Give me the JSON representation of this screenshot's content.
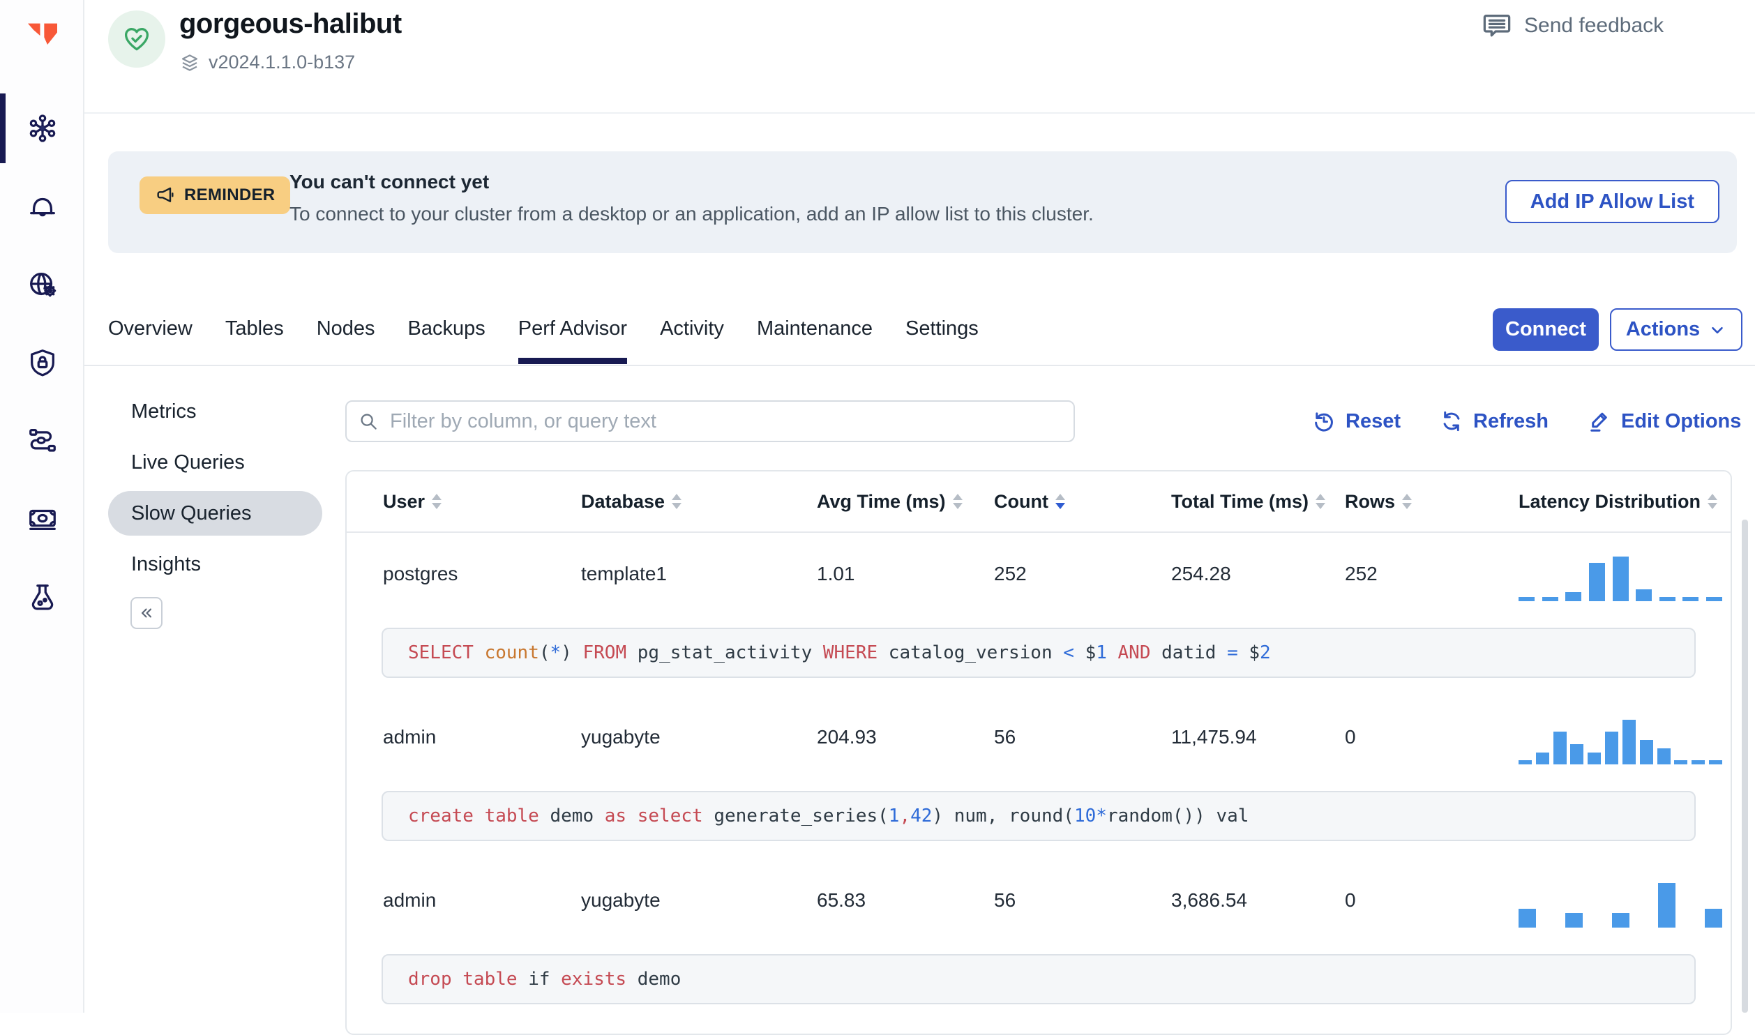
{
  "header": {
    "cluster_name": "gorgeous-halibut",
    "version": "v2024.1.1.0-b137",
    "send_feedback": "Send feedback"
  },
  "rail": {
    "icons": [
      "yugabyte-logo",
      "clusters",
      "alerts",
      "network-access",
      "security",
      "integrations",
      "usage-billing",
      "labs"
    ],
    "active": "clusters"
  },
  "banner": {
    "badge": "REMINDER",
    "title": "You can't connect yet",
    "message": "To connect to your cluster from a desktop or an application, add an IP allow list to this cluster.",
    "action": "Add IP Allow List"
  },
  "nav_tabs": {
    "items": [
      "Overview",
      "Tables",
      "Nodes",
      "Backups",
      "Perf Advisor",
      "Activity",
      "Maintenance",
      "Settings"
    ],
    "active": "Perf Advisor"
  },
  "cluster_actions": {
    "connect": "Connect",
    "actions": "Actions"
  },
  "subnav": {
    "items": [
      "Metrics",
      "Live Queries",
      "Slow Queries",
      "Insights"
    ],
    "active": "Slow Queries",
    "collapse_glyph": "«"
  },
  "toolbar": {
    "filter_placeholder": "Filter by column, or query text",
    "reset": "Reset",
    "refresh": "Refresh",
    "edit_options": "Edit Options"
  },
  "table": {
    "columns": [
      "User",
      "Database",
      "Avg Time (ms)",
      "Count",
      "Total Time (ms)",
      "Rows",
      "Latency Distribution"
    ],
    "sort": {
      "column": "Count",
      "direction": "desc"
    },
    "rows": [
      {
        "user": "postgres",
        "database": "template1",
        "avg_time_ms": "1.01",
        "count": "252",
        "total_time_ms": "254.28",
        "rows": "252",
        "query_tokens": [
          [
            "kw",
            "SELECT "
          ],
          [
            "fn",
            "count"
          ],
          [
            "p",
            "("
          ],
          [
            "num",
            "*"
          ],
          [
            "p",
            ") "
          ],
          [
            "kw",
            "FROM "
          ],
          [
            "id",
            "pg_stat_activity "
          ],
          [
            "kw",
            "WHERE "
          ],
          [
            "id",
            "catalog_version "
          ],
          [
            "num",
            "< "
          ],
          [
            "id",
            "$"
          ],
          [
            "num",
            "1 "
          ],
          [
            "kw",
            "AND "
          ],
          [
            "id",
            "datid "
          ],
          [
            "num",
            "= "
          ],
          [
            "id",
            "$"
          ],
          [
            "num",
            "2"
          ]
        ]
      },
      {
        "user": "admin",
        "database": "yugabyte",
        "avg_time_ms": "204.93",
        "count": "56",
        "total_time_ms": "11,475.94",
        "rows": "0",
        "query_tokens": [
          [
            "kw",
            "create table "
          ],
          [
            "id",
            "demo "
          ],
          [
            "kw",
            "as select "
          ],
          [
            "id",
            "generate_series"
          ],
          [
            "p",
            "("
          ],
          [
            "num",
            "1"
          ],
          [
            "kw",
            ","
          ],
          [
            "num",
            "42"
          ],
          [
            "p",
            ") "
          ],
          [
            "id",
            "num"
          ],
          [
            "p",
            ", "
          ],
          [
            "id",
            "round"
          ],
          [
            "p",
            "("
          ],
          [
            "num",
            "10"
          ],
          [
            "num",
            "*"
          ],
          [
            "id",
            "random"
          ],
          [
            "p",
            "()) "
          ],
          [
            "id",
            "val"
          ]
        ]
      },
      {
        "user": "admin",
        "database": "yugabyte",
        "avg_time_ms": "65.83",
        "count": "56",
        "total_time_ms": "3,686.54",
        "rows": "0",
        "query_tokens": [
          [
            "kw",
            "drop table "
          ],
          [
            "id",
            "if "
          ],
          [
            "kw",
            "exists "
          ],
          [
            "id",
            "demo"
          ]
        ]
      }
    ]
  },
  "chart_data": [
    {
      "type": "bar",
      "label": "latency-distribution-row-1",
      "values": [
        1,
        1,
        3,
        13,
        15,
        4,
        1,
        1,
        1
      ]
    },
    {
      "type": "bar",
      "label": "latency-distribution-row-2",
      "values": [
        1,
        3,
        8,
        5,
        3,
        8,
        11,
        6,
        4,
        1,
        1,
        1
      ]
    },
    {
      "type": "bar",
      "label": "latency-distribution-row-3",
      "values": [
        5,
        4,
        4,
        12,
        5
      ]
    }
  ],
  "colors": {
    "accent_blue": "#3a5bcb",
    "link_blue": "#2d53c4",
    "bar_blue": "#4a9ae8",
    "navy": "#181a52",
    "reminder_bg": "#f8ce82",
    "banner_bg": "#edf1f6",
    "status_green": "#3aa765"
  }
}
